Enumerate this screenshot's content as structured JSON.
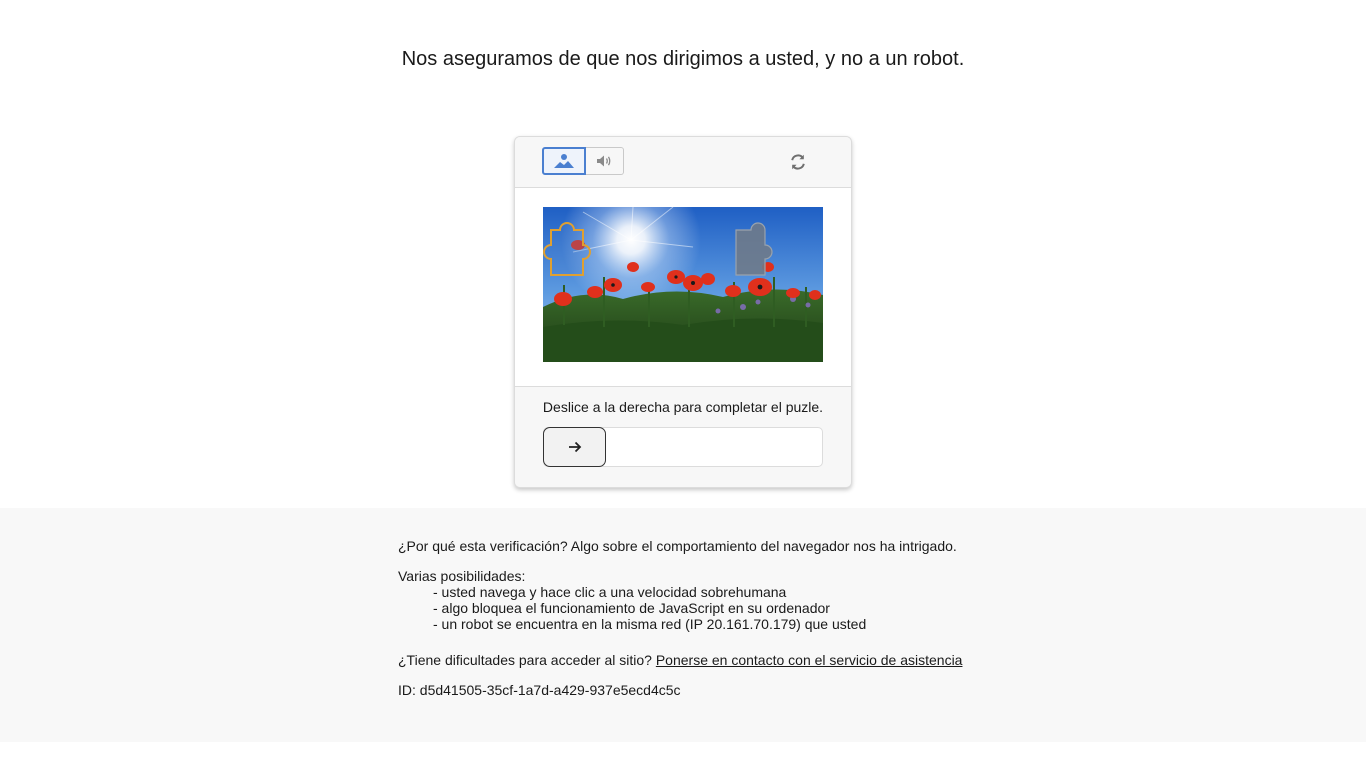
{
  "page": {
    "headline": "Nos aseguramos de que nos dirigimos a usted, y no a un robot."
  },
  "captcha": {
    "modes": [
      {
        "name": "image",
        "icon": "image-icon",
        "active": true
      },
      {
        "name": "audio",
        "icon": "speaker-icon",
        "active": false
      }
    ],
    "refresh_icon": "refresh-icon",
    "instruction": "Deslice a la derecha para completar el puzle.",
    "slider": {
      "handle_icon": "arrow-right-icon",
      "progress": 0
    }
  },
  "explanation": {
    "why": "¿Por qué esta verificación? Algo sobre el comportamiento del navegador nos ha intrigado.",
    "possibilities_title": "Varias posibilidades:",
    "possibilities": [
      "- usted navega y hace clic a una velocidad sobrehumana",
      "- algo bloquea el funcionamiento de JavaScript en su ordenador",
      "- un robot se encuentra en la misma red (IP 20.161.70.179) que usted"
    ],
    "support_question": "¿Tiene dificultades para acceder al sitio? ",
    "support_link": "Ponerse en contacto con el servicio de asistencia",
    "id_line": "ID: d5d41505-35cf-1a7d-a429-937e5ecd4c5c"
  },
  "colors": {
    "accent": "#4a7fd0",
    "footer_bg": "#f8f8f8",
    "puzzle_outline": "#e0a030"
  }
}
